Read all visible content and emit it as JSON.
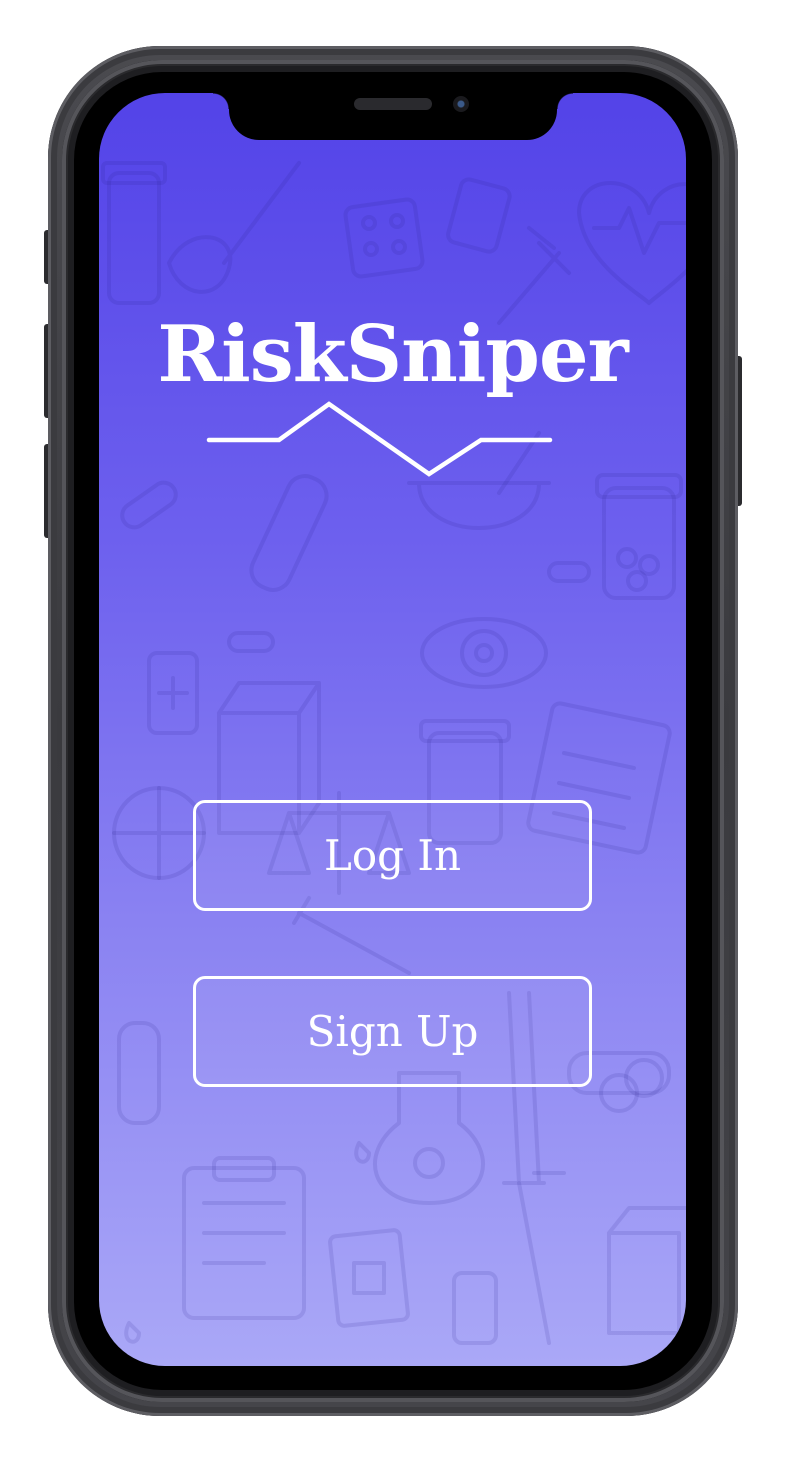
{
  "app": {
    "title": "RiskSniper"
  },
  "auth": {
    "login_label": "Log In",
    "signup_label": "Sign Up"
  },
  "theme": {
    "gradient_top": "#5343e8",
    "gradient_bottom": "#aaa8f7",
    "text_color": "#ffffff"
  },
  "icons": {
    "logo_mark": "heartbeat-pulse-icon",
    "background_pattern": "medical-doodles"
  }
}
